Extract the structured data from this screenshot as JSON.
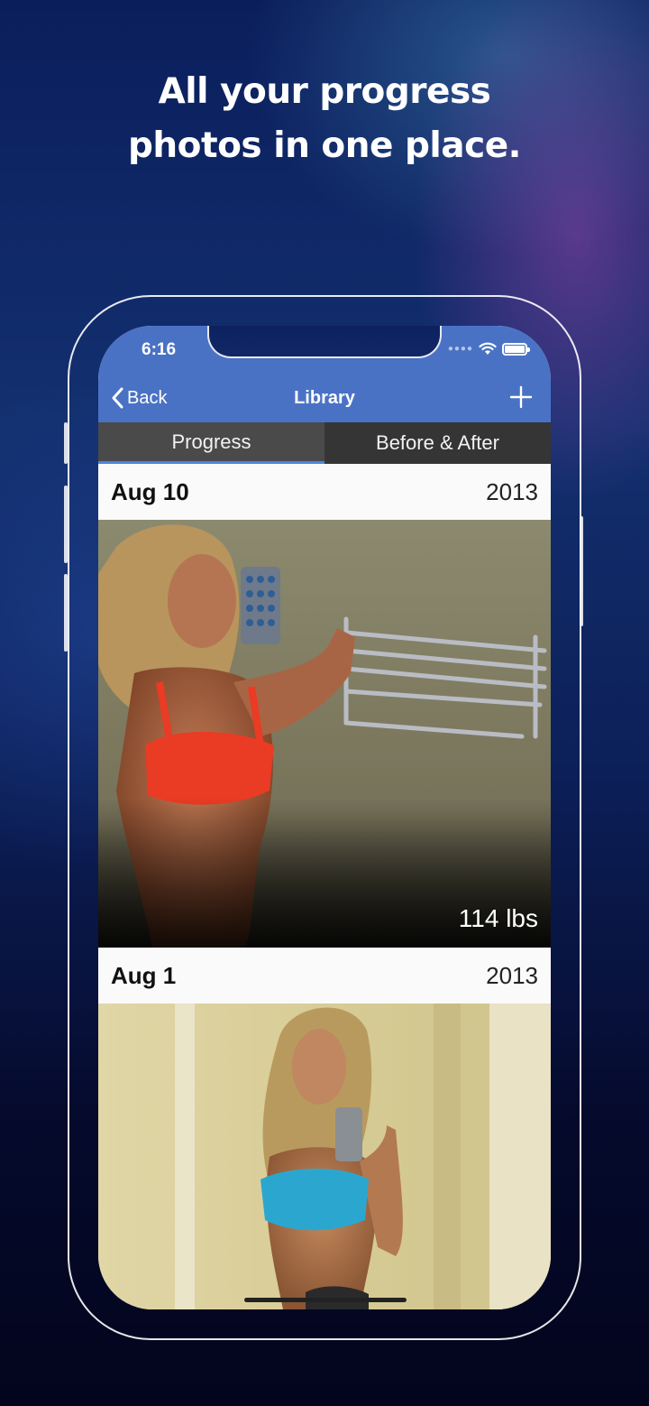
{
  "headline": {
    "line1": "All your progress",
    "line2": "photos in one place."
  },
  "status_bar": {
    "time": "6:16",
    "icons": [
      "signal-icon",
      "wifi-icon",
      "battery-icon"
    ]
  },
  "navbar": {
    "back_label": "Back",
    "title": "Library",
    "add_icon": "plus-icon",
    "color": "#4a72c4"
  },
  "segments": {
    "items": [
      {
        "label": "Progress",
        "active": true
      },
      {
        "label": "Before & After",
        "active": false
      }
    ],
    "accent": "#4a86e0"
  },
  "entries": [
    {
      "date": "Aug 10",
      "year": "2013",
      "weight": "114 lbs"
    },
    {
      "date": "Aug 1",
      "year": "2013"
    }
  ]
}
